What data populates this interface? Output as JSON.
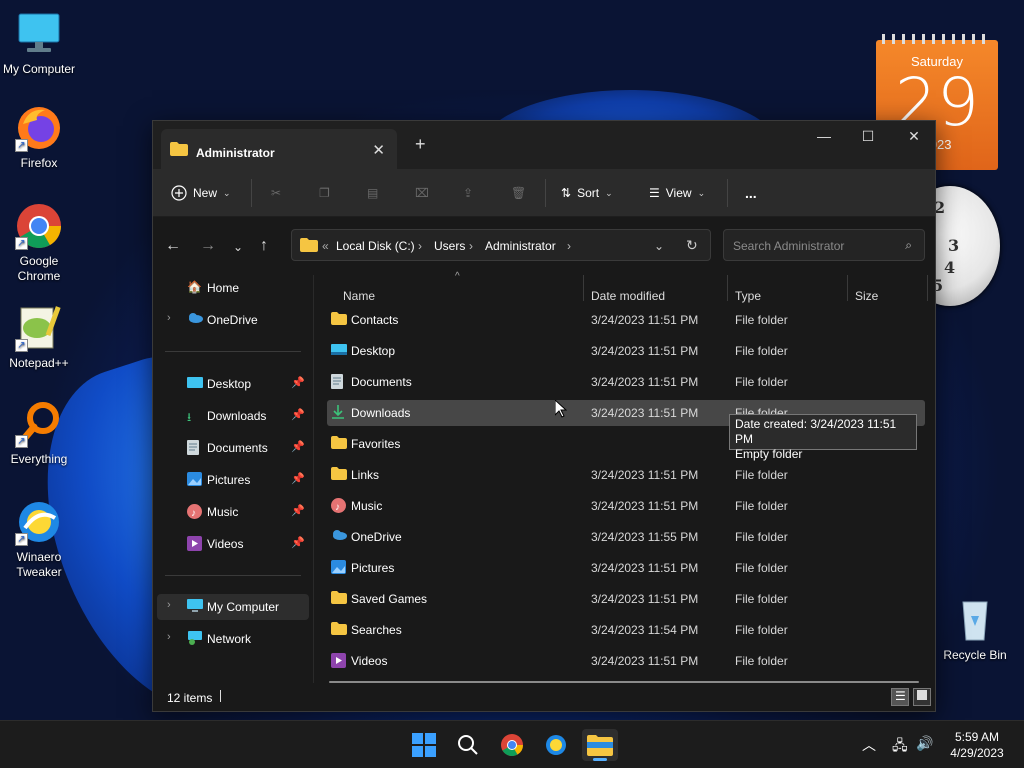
{
  "desktop": {
    "icons": [
      {
        "label": "My Computer"
      },
      {
        "label": "Firefox"
      },
      {
        "label": "Google Chrome"
      },
      {
        "label": "Notepad++"
      },
      {
        "label": "Everything"
      },
      {
        "label": "Winaero Tweaker"
      },
      {
        "label": "Recycle Bin"
      }
    ],
    "calendar": {
      "day": "Saturday",
      "date": "29",
      "year": "2023"
    },
    "clock_numerals": [
      "2",
      "3",
      "4",
      "5"
    ]
  },
  "window": {
    "tab_title": "Administrator",
    "new_tab": "+",
    "toolbar": {
      "new_label": "New",
      "sort_label": "Sort",
      "view_label": "View",
      "more_label": "..."
    },
    "address": {
      "prefix": "«",
      "crumbs": [
        "Local Disk (C:)",
        "Users",
        "Administrator"
      ],
      "separator": "›"
    },
    "search": {
      "placeholder": "Search Administrator"
    },
    "nav": {
      "home": "Home",
      "onedrive": "OneDrive",
      "quick": [
        "Desktop",
        "Downloads",
        "Documents",
        "Pictures",
        "Music",
        "Videos"
      ],
      "my_computer": "My Computer",
      "network": "Network"
    },
    "columns": {
      "name": "Name",
      "date": "Date modified",
      "type": "Type",
      "size": "Size"
    },
    "rows": [
      {
        "name": "Contacts",
        "date": "3/24/2023 11:51 PM",
        "type": "File folder",
        "icon": "folder-icon"
      },
      {
        "name": "Desktop",
        "date": "3/24/2023 11:51 PM",
        "type": "File folder",
        "icon": "desktop-icon"
      },
      {
        "name": "Documents",
        "date": "3/24/2023 11:51 PM",
        "type": "File folder",
        "icon": "documents-icon"
      },
      {
        "name": "Downloads",
        "date": "3/24/2023 11:51 PM",
        "type": "File folder",
        "icon": "downloads-icon"
      },
      {
        "name": "Favorites",
        "date": "",
        "type": "File folder",
        "icon": "folder-icon"
      },
      {
        "name": "Links",
        "date": "3/24/2023 11:51 PM",
        "type": "File folder",
        "icon": "folder-icon"
      },
      {
        "name": "Music",
        "date": "3/24/2023 11:51 PM",
        "type": "File folder",
        "icon": "music-icon"
      },
      {
        "name": "OneDrive",
        "date": "3/24/2023 11:55 PM",
        "type": "File folder",
        "icon": "onedrive-icon"
      },
      {
        "name": "Pictures",
        "date": "3/24/2023 11:51 PM",
        "type": "File folder",
        "icon": "pictures-icon"
      },
      {
        "name": "Saved Games",
        "date": "3/24/2023 11:51 PM",
        "type": "File folder",
        "icon": "folder-icon"
      },
      {
        "name": "Searches",
        "date": "3/24/2023 11:54 PM",
        "type": "File folder",
        "icon": "folder-icon"
      },
      {
        "name": "Videos",
        "date": "3/24/2023 11:51 PM",
        "type": "File folder",
        "icon": "videos-icon"
      }
    ],
    "tooltip": {
      "line1": "Date created: 3/24/2023 11:51 PM",
      "line2": "Empty folder"
    },
    "status": {
      "count": "12 items"
    }
  },
  "taskbar": {
    "time": "5:59 AM",
    "date": "4/29/2023"
  },
  "colors": {
    "accent": "#58b0ff",
    "folder": "#f5c542",
    "calendar": "#f07a24"
  }
}
